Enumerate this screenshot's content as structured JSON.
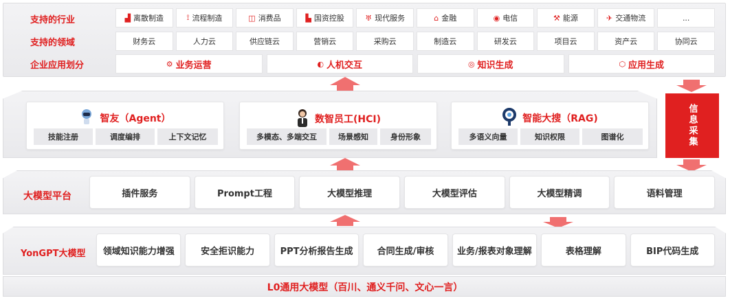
{
  "top": {
    "industries_label": "支持的行业",
    "industries": [
      {
        "label": "离散制造",
        "icon": "factory-icon"
      },
      {
        "label": "流程制造",
        "icon": "pipeline-icon"
      },
      {
        "label": "消费品",
        "icon": "shopping-bag-icon"
      },
      {
        "label": "国资控股",
        "icon": "building-icon"
      },
      {
        "label": "现代服务",
        "icon": "service-icon"
      },
      {
        "label": "金融",
        "icon": "bank-icon"
      },
      {
        "label": "电信",
        "icon": "antenna-icon"
      },
      {
        "label": "能源",
        "icon": "oil-rig-icon"
      },
      {
        "label": "交通物流",
        "icon": "plane-icon"
      },
      {
        "label": "...",
        "icon": ""
      }
    ],
    "domains_label": "支持的领域",
    "domains": [
      "财务云",
      "人力云",
      "供应链云",
      "营销云",
      "采购云",
      "制造云",
      "研发云",
      "项目云",
      "资产云",
      "协同云"
    ],
    "apps_label": "企业应用划分",
    "apps": [
      {
        "label": "业务运营",
        "icon": "gears-icon"
      },
      {
        "label": "人机交互",
        "icon": "head-icon"
      },
      {
        "label": "知识生成",
        "icon": "brain-icon"
      },
      {
        "label": "应用生成",
        "icon": "cube-icon"
      }
    ]
  },
  "agents": [
    {
      "title": "智友（Agent）",
      "icon": "robot-icon",
      "chips": [
        "技能注册",
        "调度编排",
        "上下文记忆"
      ]
    },
    {
      "title": "数智员工(HCI)",
      "icon": "person-icon",
      "chips": [
        "多模态、多端交互",
        "场景感知",
        "身份形象"
      ]
    },
    {
      "title": "智能大搜（RAG)",
      "icon": "search-icon",
      "chips": [
        "多语义向量",
        "知识权限",
        "图谱化"
      ]
    }
  ],
  "side_box": "信息采集",
  "platform": {
    "label": "大模型平台",
    "items": [
      "插件服务",
      "Prompt工程",
      "大模型推理",
      "大模型评估",
      "大模型精调",
      "语料管理"
    ]
  },
  "yongpt": {
    "label": "YonGPT大模型",
    "items": [
      "领域知识能力增强",
      "安全拒识能力",
      "PPT分析报告生成",
      "合同生成/审核",
      "业务/报表对象理解",
      "表格理解",
      "BIP代码生成"
    ]
  },
  "base": {
    "label": "L0通用大模型（百川、通义千问、文心一言）"
  },
  "colors": {
    "accent": "#e02020",
    "layer_bg": "#efeff1"
  }
}
